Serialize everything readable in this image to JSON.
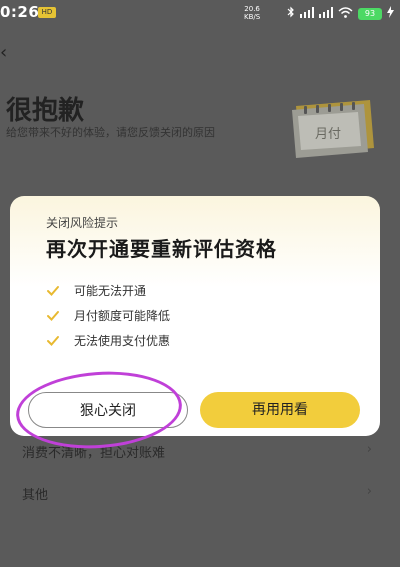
{
  "status_bar": {
    "time": "0:26",
    "badge": "HD",
    "speed_value": "20.6",
    "speed_unit": "KB/S",
    "battery": "93"
  },
  "background": {
    "back_icon": "chevron-left-icon",
    "title": "很抱歉",
    "subtitle": "给您带来不好的体验，请您反馈关闭的原因",
    "calendar_text": "月付",
    "rows": [
      {
        "label": "消费不清晰，担心对账难"
      },
      {
        "label": "其他"
      }
    ]
  },
  "modal": {
    "label": "关闭风险提示",
    "title": "再次开通要重新评估资格",
    "items": [
      "可能无法开通",
      "月付额度可能降低",
      "无法使用支付优惠"
    ],
    "close_button": "狠心关闭",
    "keep_button": "再用用看"
  },
  "colors": {
    "accent": "#f2cd3c",
    "annotation": "#c040d8",
    "check": "#e8b930"
  }
}
